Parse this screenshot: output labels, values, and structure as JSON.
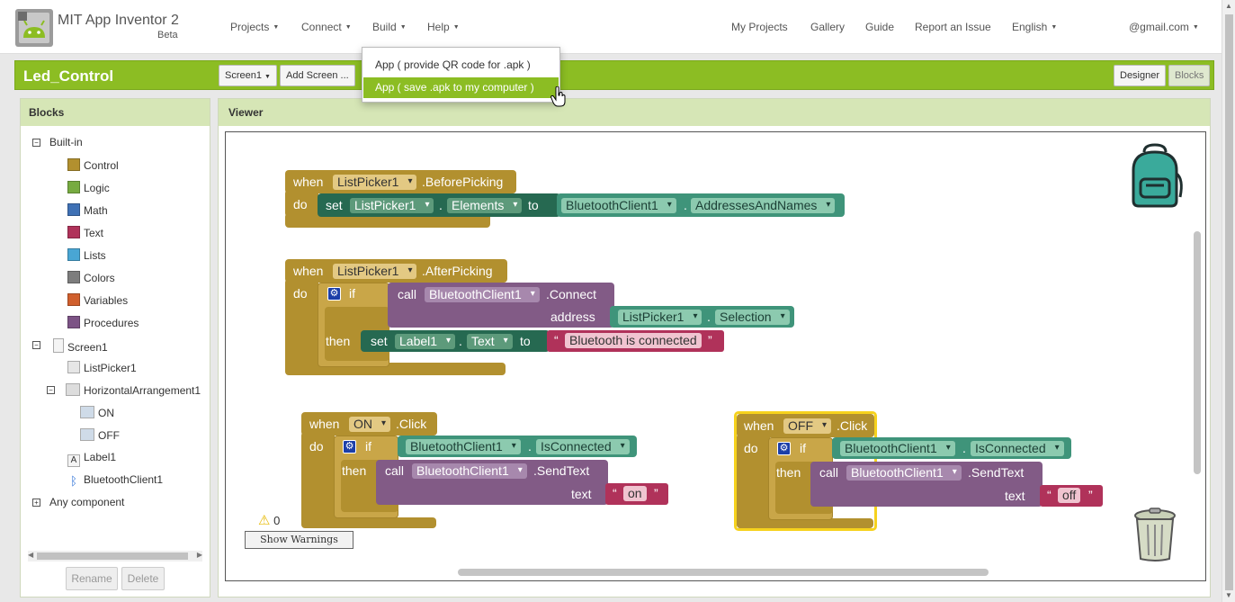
{
  "app": {
    "title": "MIT App Inventor 2",
    "beta": "Beta"
  },
  "topmenu": {
    "projects": "Projects",
    "connect": "Connect",
    "build": "Build",
    "help": "Help",
    "my_projects": "My Projects",
    "gallery": "Gallery",
    "guide": "Guide",
    "report_issue": "Report an Issue",
    "language": "English",
    "account_suffix": "@gmail.com"
  },
  "project": {
    "name": "Led_Control",
    "screen_select": "Screen1",
    "add_screen": "Add Screen ...",
    "designer": "Designer",
    "blocks": "Blocks"
  },
  "build_menu": {
    "item_qr": "App ( provide QR code for .apk )",
    "item_save": "App ( save .apk to my computer )"
  },
  "blocks_panel": {
    "title": "Blocks",
    "builtin": "Built-in",
    "builtin_items": [
      {
        "label": "Control",
        "color": "#b2902f"
      },
      {
        "label": "Logic",
        "color": "#77ab41"
      },
      {
        "label": "Math",
        "color": "#3f71b5"
      },
      {
        "label": "Text",
        "color": "#b0325a"
      },
      {
        "label": "Lists",
        "color": "#49a6d4"
      },
      {
        "label": "Colors",
        "color": "#7d7d7d"
      },
      {
        "label": "Variables",
        "color": "#d05f2d"
      },
      {
        "label": "Procedures",
        "color": "#7c5385"
      }
    ],
    "screen": "Screen1",
    "components": {
      "listpicker": "ListPicker1",
      "harrangement": "HorizontalArrangement1",
      "on": "ON",
      "off": "OFF",
      "label": "Label1",
      "bluetooth": "BluetoothClient1"
    },
    "any_component": "Any component",
    "rename": "Rename",
    "delete": "Delete"
  },
  "viewer": {
    "title": "Viewer",
    "warnings_count": "0",
    "show_warnings": "Show Warnings"
  },
  "code": {
    "when": "when",
    "do": "do",
    "set": "set",
    "to": "to",
    "if": "if",
    "then": "then",
    "call": "call",
    "address": "address",
    "text": "text",
    "dot": ".",
    "qopen": "“",
    "qclose": "”",
    "listpicker1": "ListPicker1",
    "before_picking": ".BeforePicking",
    "after_picking": ".AfterPicking",
    "elements": "Elements",
    "bluetooth1": "BluetoothClient1",
    "addresses_and_names": "AddressesAndNames",
    "connect": ".Connect",
    "selection": "Selection",
    "label1": "Label1",
    "text_prop": "Text",
    "connected_msg": "Bluetooth is connected",
    "on_btn": "ON",
    "off_btn": "OFF",
    "click": ".Click",
    "is_connected": "IsConnected",
    "send_text": ".SendText",
    "on_str": "on",
    "off_str": "off"
  }
}
